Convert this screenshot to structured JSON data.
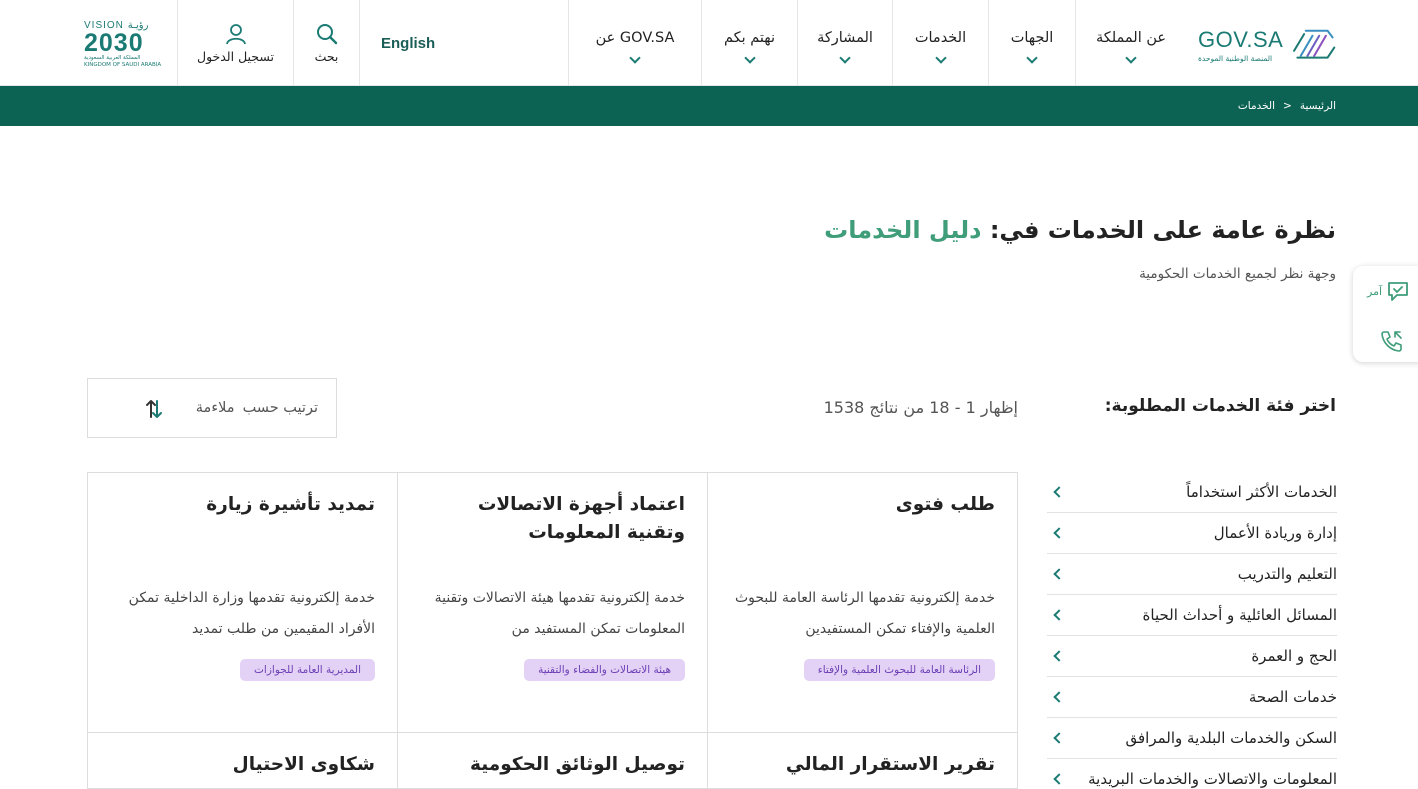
{
  "header": {
    "logo": {
      "name": "GOV.SA",
      "subtitle": "المنصة الوطنية الموحدة"
    },
    "nav": [
      {
        "label": "عن المملكة"
      },
      {
        "label": "الجهات"
      },
      {
        "label": "الخدمات"
      },
      {
        "label": "المشاركة"
      },
      {
        "label": "نهتم بكم"
      },
      {
        "label": "عن GOV.SA"
      }
    ],
    "language": "English",
    "search_label": "بحث",
    "login_label": "تسجيل الدخول",
    "vision": {
      "top": "VISION رؤيـة",
      "year": "2030",
      "line1": "المملكة العربية السعودية",
      "line2": "KINGDOM OF SAUDI ARABIA"
    }
  },
  "breadcrumb": {
    "home": "الرئيسية",
    "separator": ">",
    "current": "الخدمات"
  },
  "page": {
    "title_prefix": "نظرة عامة على الخدمات في:",
    "title_accent": "دليل الخدمات",
    "subtitle": "وجهة نظر لجميع الخدمات الحكومية"
  },
  "widget": {
    "label": "آمر"
  },
  "filter": {
    "category_title": "اختر فئة الخدمات المطلوبة:",
    "results_text": "إظهار 1 - 18 من نتائج 1538",
    "sort_label": "ترتيب حسب",
    "sort_value": "ملاءمة"
  },
  "categories": [
    {
      "label": "الخدمات الأكثر استخداماً"
    },
    {
      "label": "إدارة وريادة الأعمال"
    },
    {
      "label": "التعليم والتدريب"
    },
    {
      "label": "المسائل العائلية و أحداث الحياة"
    },
    {
      "label": "الحج و العمرة"
    },
    {
      "label": "خدمات الصحة"
    },
    {
      "label": "السكن والخدمات البلدية والمرافق"
    },
    {
      "label": "المعلومات والاتصالات والخدمات البريدية"
    }
  ],
  "cards": [
    {
      "title": "طلب فتوى",
      "desc": "خدمة إلكترونية تقدمها الرئاسة العامة للبحوث العلمية والإفتاء تمكن المستفيدين",
      "tag": "الرئاسة العامة للبحوث العلمية والإفتاء"
    },
    {
      "title": "اعتماد أجهزة الاتصالات وتقنية المعلومات",
      "desc": "خدمة إلكترونية تقدمها هيئة الاتصالات وتقنية المعلومات تمكن المستفيد من",
      "tag": "هيئة الاتصالات والفضاء والتقنية"
    },
    {
      "title": "تمديد تأشيرة زيارة",
      "desc": "خدمة إلكترونية تقدمها وزارة الداخلية تمكن الأفراد المقيمين من طلب تمديد",
      "tag": "المديرية العامة للجوازات"
    },
    {
      "title": "تقرير الاستقرار المالي"
    },
    {
      "title": "توصيل الوثائق الحكومية"
    },
    {
      "title": "شكاوى الاحتيال"
    }
  ]
}
